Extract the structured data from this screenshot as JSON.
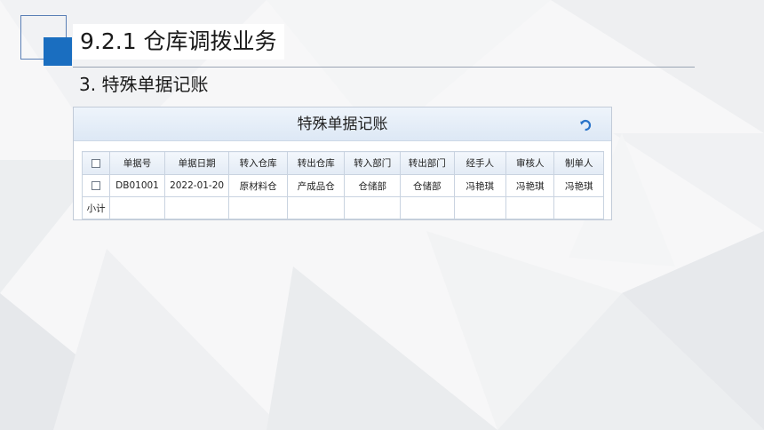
{
  "slide": {
    "heading": "9.2.1  仓库调拨业务",
    "subheading": "3. 特殊单据记账"
  },
  "app": {
    "title": "特殊单据记账",
    "refresh_icon": "refresh-icon",
    "columns": [
      "单据号",
      "单据日期",
      "转入仓库",
      "转出仓库",
      "转入部门",
      "转出部门",
      "经手人",
      "审核人",
      "制单人"
    ],
    "rows": [
      {
        "checked": false,
        "cells": [
          "DB01001",
          "2022-01-20",
          "原材料仓",
          "产成品仓",
          "仓储部",
          "仓储部",
          "冯艳琪",
          "冯艳琪",
          "冯艳琪"
        ]
      }
    ],
    "subtotal_label": "小计"
  },
  "colors": {
    "accent": "#1a6ec0",
    "outline": "#5a7fb6",
    "header_bg": "#e3ebf5",
    "subtotal_bg": "#fbf8e4"
  }
}
